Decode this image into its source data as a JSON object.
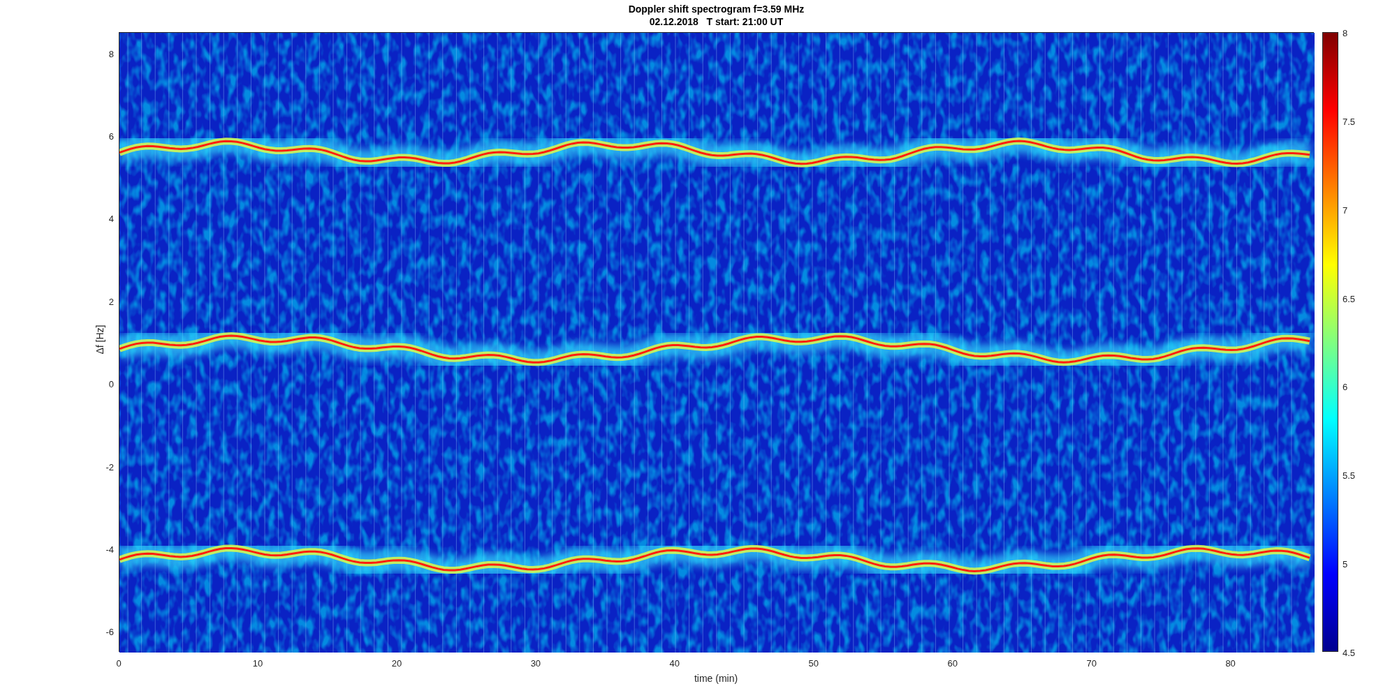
{
  "title_lines": [
    "Doppler shift spectrogram f=3.59 MHz",
    "02.12.2018   T start: 21:00 UT"
  ],
  "ylabel": "Δf [Hz]",
  "xlabel": "time (min)",
  "yticks": [
    "8",
    "6",
    "4",
    "2",
    "0",
    "-2",
    "-4",
    "-6"
  ],
  "xticks": [
    "0",
    "10",
    "20",
    "30",
    "40",
    "50",
    "60",
    "70",
    "80"
  ],
  "colorbar_ticks": [
    "8",
    "7.5",
    "7",
    "6.5",
    "6",
    "5.5",
    "5",
    "4.5"
  ]
}
